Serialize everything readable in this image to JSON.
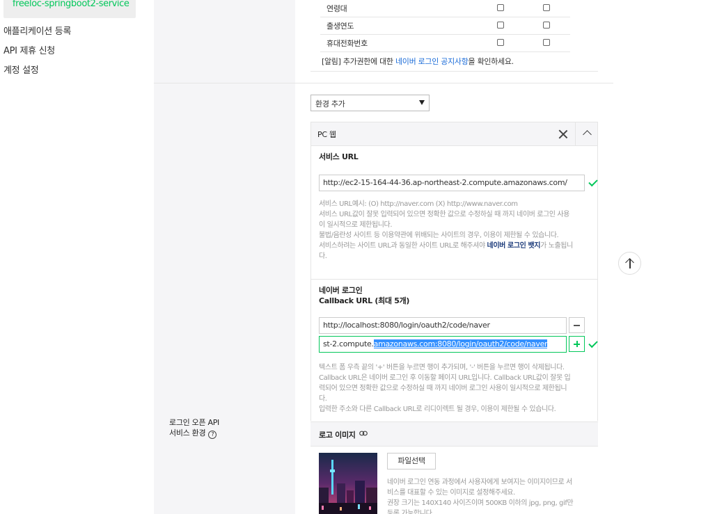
{
  "sidebar": {
    "app_name": "freeloc-springboot2-service",
    "links": [
      "애플리케이션 등록",
      "API 제휴 신청",
      "계정 설정"
    ]
  },
  "permissions": {
    "rows": [
      "연령대",
      "출생연도",
      "휴대전화번호"
    ],
    "notice_prefix": "[알림] 추가권한에 대한 ",
    "notice_link": "네이버 로그인 공지사항",
    "notice_suffix": "을 확인하세요."
  },
  "environment": {
    "select_label": "환경 추가",
    "section_label_line1": "로그인 오픈 API",
    "section_label_line2": "서비스 환경",
    "help_icon_glyph": "?"
  },
  "pc_web": {
    "title": "PC 웹",
    "service_url_title": "서비스 URL",
    "service_url_value": "http://ec2-15-164-44-36.ap-northeast-2.compute.amazonaws.com/",
    "service_url_desc": [
      "서비스 URL예시: (O) http://naver.com (X) http://www.naver.com",
      "서비스 URL값이 잘못 입력되어 있으면 정확한 값으로 수정하실 때 까지 네이버 로그인 사용",
      "이 일시적으로 제한됩니다.",
      "불법/음란성 사이트 등 이용약관에 위배되는 사이트의 경우, 이용이 제한될 수 있습니다.",
      "서비스하려는 사이트 URL과 동일한 사이트 URL로 해주셔야 ",
      "가 노출됩니",
      "다."
    ],
    "badge_link_text": "네이버 로그인 뱃지",
    "callback_title_line1": "네이버 로그인",
    "callback_title_line2": "Callback URL (최대 5개)",
    "callback_1": "http://localhost:8080/login/oauth2/code/naver",
    "callback_2_prefix": "st-2.compute.",
    "callback_2_selected": "amazonaws.com:8080/login/oauth2/code/naver",
    "callback_desc": [
      "텍스트 폼 우측 끝의 '+' 버튼을 누르면 행이 추가되며, '-' 버튼을 누르면 행이 삭제됩니다.",
      "Callback URL은 네이버 로그인 후 이동할 페이지 URL입니다. Callback URL값이 잘못 입",
      "력되어 있으면 정확한 값으로 수정하실 때 까지 네이버 로그인 사용이 일시적으로 제한됩니",
      "다.",
      "입력한 주소와 다른 Callback URL로 리디이렉트 될 경우, 이용이 제한될 수 있습니다."
    ]
  },
  "logo_image": {
    "title": "로고 이미지",
    "file_button": "파일선택",
    "desc": [
      "네이버 로그인 연동 과정에서 사용자에게 보여지는 이미지이므로 서",
      "비스를 대표할 수 있는 이미지로 설정해주세요.",
      "권장 크기는 140X140 사이즈이며 500KB 이하의 jpg, png, gif만",
      "등록 가능합니다."
    ]
  },
  "colors": {
    "accent_green": "#03c75a",
    "link_blue": "#1a6bd8",
    "selection_blue": "#3390ff"
  }
}
